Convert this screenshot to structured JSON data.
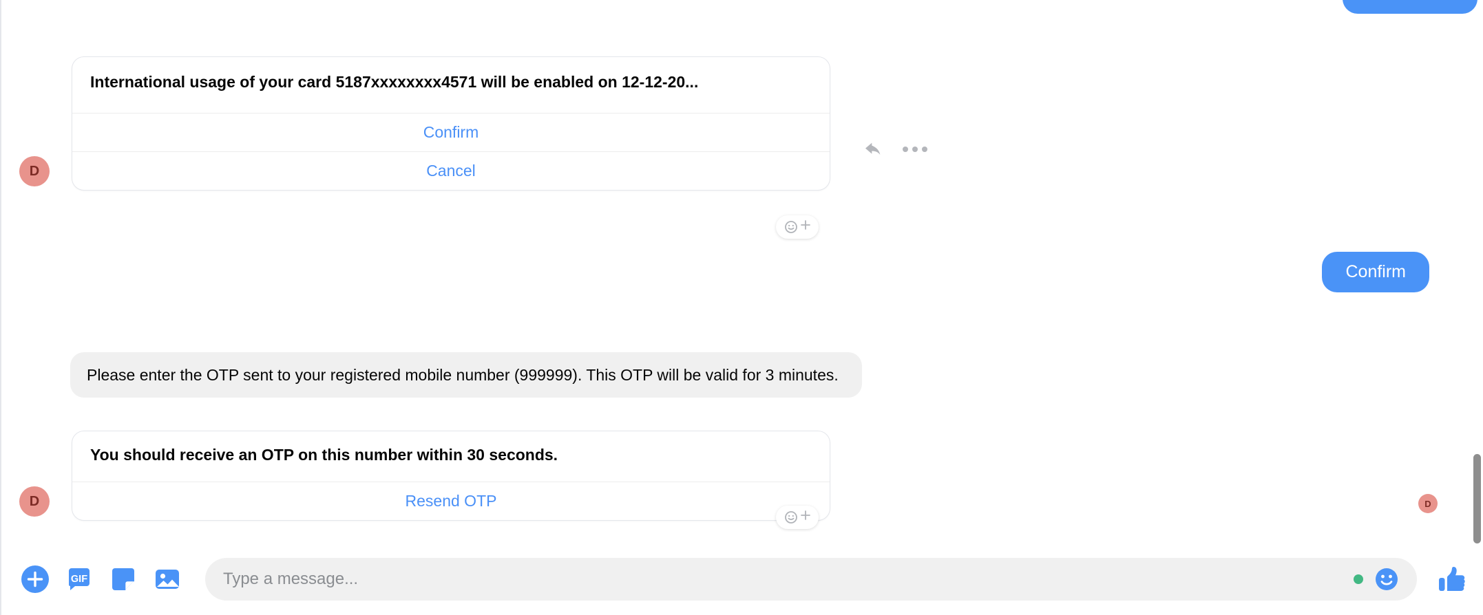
{
  "colors": {
    "messenger_blue": "#4a93f7",
    "link_blue": "#4a90f7",
    "avatar_bg": "#e8938c",
    "avatar_fg": "#7d2b25",
    "bubble_gray": "#f0f0f0",
    "card_border": "#e4e6eb",
    "text_primary": "#050505",
    "placeholder": "#8a8d91",
    "online_green": "#42b883",
    "scrollbar": "#8e8e8e"
  },
  "thread": {
    "partial_outgoing_bubble": {
      "kind": "outgoing",
      "clipped": true,
      "label": ""
    },
    "messages": [
      {
        "id": "card-international-usage",
        "side": "incoming",
        "avatar_letter": "D",
        "type": "generic-template-card",
        "title": "International usage of your card 5187xxxxxxxx4571 will be enabled on 12-12-20...",
        "buttons": [
          {
            "label": "Confirm",
            "name": "card-confirm-button"
          },
          {
            "label": "Cancel",
            "name": "card-cancel-button"
          }
        ],
        "hover_actions": [
          {
            "icon": "reply-icon",
            "name": "reply-action"
          },
          {
            "icon": "more-options-icon",
            "name": "more-options-action"
          }
        ],
        "react_button": {
          "icon": "add-reaction-icon",
          "name": "add-reaction-button"
        }
      },
      {
        "id": "outgoing-confirm",
        "side": "outgoing",
        "type": "text-bubble",
        "text": "Confirm"
      },
      {
        "id": "otp-instructions",
        "side": "incoming",
        "type": "text-bubble",
        "text": "Please enter the OTP sent to your registered mobile number (999999). This OTP will be valid for 3 minutes."
      },
      {
        "id": "card-resend-otp",
        "side": "incoming",
        "avatar_letter": "D",
        "type": "generic-template-card",
        "title": "You should receive an OTP on this number within 30 seconds.",
        "buttons": [
          {
            "label": "Resend OTP",
            "name": "resend-otp-button"
          }
        ],
        "react_button": {
          "icon": "add-reaction-icon",
          "name": "add-reaction-button"
        }
      }
    ],
    "seen_avatar_letter": "D"
  },
  "composer": {
    "tools": [
      {
        "name": "add-attachment-button",
        "icon": "plus-circle-icon",
        "label": ""
      },
      {
        "name": "gif-button",
        "icon": "gif-icon",
        "label": "GIF"
      },
      {
        "name": "sticker-button",
        "icon": "sticker-icon",
        "label": ""
      },
      {
        "name": "photo-button",
        "icon": "image-icon",
        "label": ""
      }
    ],
    "input_value": "",
    "input_placeholder": "Type a message...",
    "emoji_button": {
      "name": "emoji-picker-button",
      "icon": "smiley-icon"
    },
    "like_button": {
      "name": "like-thumbs-up-button",
      "icon": "thumbs-up-icon"
    }
  }
}
